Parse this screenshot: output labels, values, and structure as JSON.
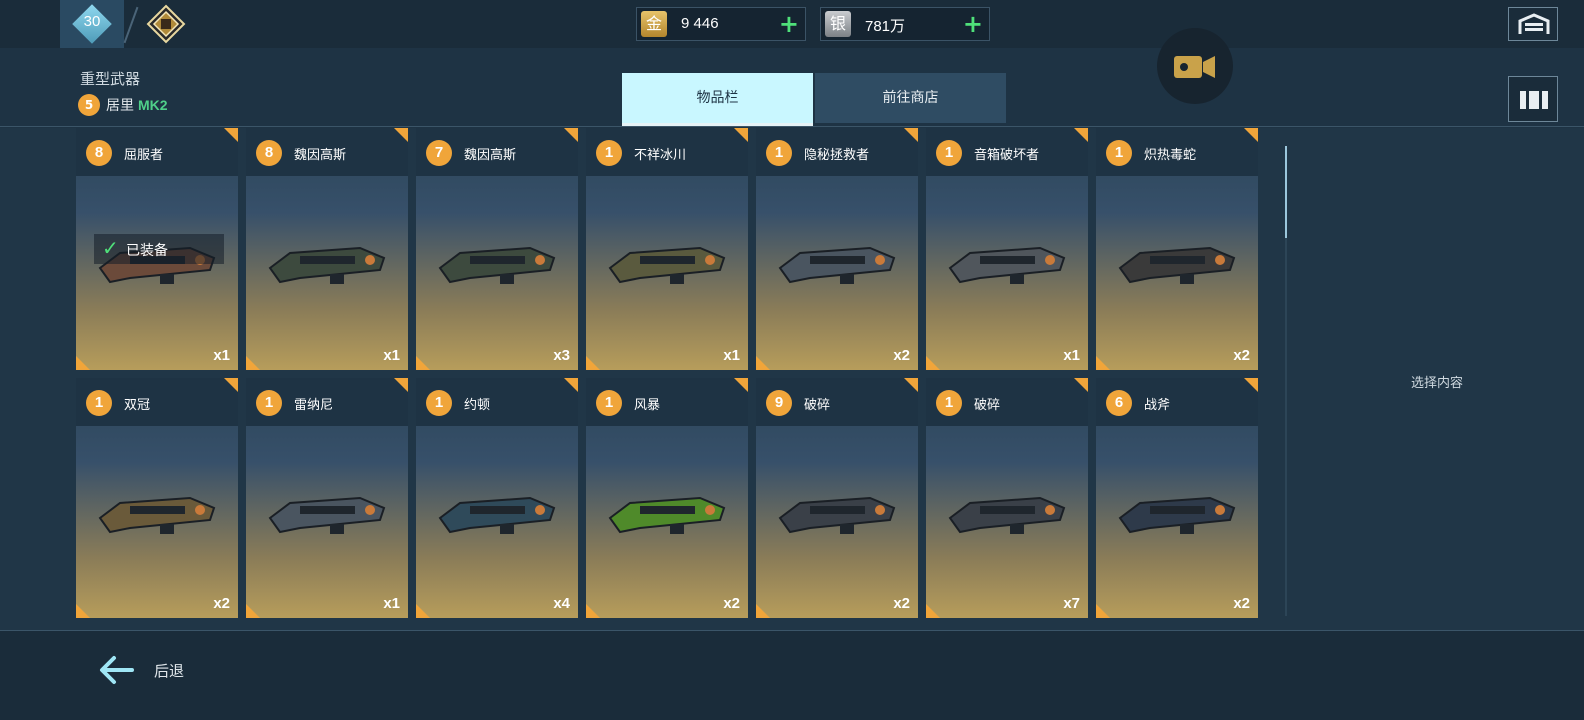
{
  "topbar": {
    "level": "30",
    "rank_icon": "rank-emblem-icon",
    "gold": {
      "icon_char": "金",
      "value": "9 446"
    },
    "silver": {
      "icon_char": "银",
      "value": "781万"
    },
    "plus": "+",
    "garage_icon": "garage-icon"
  },
  "header": {
    "category": "重型武器",
    "sub_level": "5",
    "sub_name": "居里",
    "sub_mk": "MK2"
  },
  "tabs": [
    {
      "label": "物品栏",
      "active": true
    },
    {
      "label": "前往商店",
      "active": false
    }
  ],
  "items": [
    {
      "level": "8",
      "name": "屈服者",
      "count": "x1",
      "equipped": true,
      "equipped_label": "已装备",
      "color": "#6b4a3a"
    },
    {
      "level": "8",
      "name": "魏因高斯",
      "count": "x1",
      "equipped": false,
      "color": "#3d4a3e"
    },
    {
      "level": "7",
      "name": "魏因高斯",
      "count": "x3",
      "equipped": false,
      "color": "#3d4a3e"
    },
    {
      "level": "1",
      "name": "不祥冰川",
      "count": "x1",
      "equipped": false,
      "color": "#5a5a3e"
    },
    {
      "level": "1",
      "name": "隐秘拯救者",
      "count": "x2",
      "equipped": false,
      "color": "#4a5560"
    },
    {
      "level": "1",
      "name": "音箱破坏者",
      "count": "x1",
      "equipped": false,
      "color": "#50565c"
    },
    {
      "level": "1",
      "name": "炽热毒蛇",
      "count": "x2",
      "equipped": false,
      "color": "#3a3a3a"
    },
    {
      "level": "1",
      "name": "双冠",
      "count": "x2",
      "equipped": false,
      "color": "#6a5a3a"
    },
    {
      "level": "1",
      "name": "雷纳尼",
      "count": "x1",
      "equipped": false,
      "color": "#4a5560"
    },
    {
      "level": "1",
      "name": "约顿",
      "count": "x4",
      "equipped": false,
      "color": "#2f4a5a"
    },
    {
      "level": "1",
      "name": "风暴",
      "count": "x2",
      "equipped": false,
      "color": "#4f8a2a"
    },
    {
      "level": "9",
      "name": "破碎",
      "count": "x2",
      "equipped": false,
      "color": "#3a4048"
    },
    {
      "level": "1",
      "name": "破碎",
      "count": "x7",
      "equipped": false,
      "color": "#3a4048"
    },
    {
      "level": "6",
      "name": "战斧",
      "count": "x2",
      "equipped": false,
      "color": "#2e3a4a"
    }
  ],
  "detail": {
    "placeholder": "选择内容"
  },
  "footer": {
    "back_label": "后退"
  },
  "colors": {
    "accent_orange": "#f0a53a",
    "accent_green": "#4fe07a",
    "tab_active": "#c9f7ff",
    "background": "#203647"
  }
}
